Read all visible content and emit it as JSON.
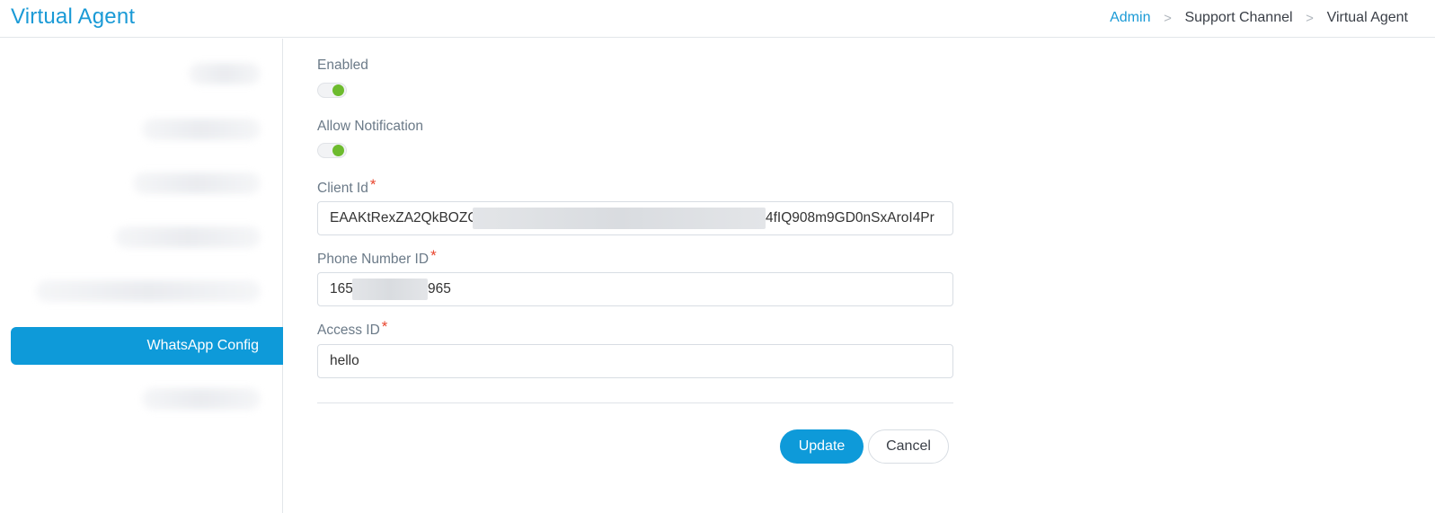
{
  "header": {
    "title": "Virtual Agent"
  },
  "breadcrumb": [
    "Admin",
    "Support Channel",
    "Virtual Agent"
  ],
  "sidebar": {
    "active_item": "WhatsApp Config"
  },
  "form": {
    "enabled": {
      "label": "Enabled",
      "value": true
    },
    "allow_notification": {
      "label": "Allow Notification",
      "value": true
    },
    "client_id": {
      "label": "Client Id",
      "required": "*",
      "value_start": "EAAKtRexZA2QkBOZC",
      "value_end": "4fIQ908m9GD0nSxAroI4Pr"
    },
    "phone_number_id": {
      "label": "Phone Number ID",
      "required": "*",
      "value_start": "165",
      "value_end": "965"
    },
    "access_id": {
      "label": "Access ID",
      "required": "*",
      "value": "hello"
    }
  },
  "actions": {
    "update_label": "Update",
    "cancel_label": "Cancel"
  },
  "colors": {
    "accent": "#0e9ad9",
    "toggle_on": "#6dbb2e",
    "required": "#e8452e"
  }
}
